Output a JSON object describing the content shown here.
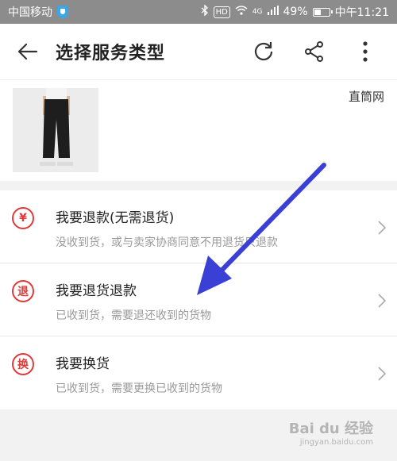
{
  "status_bar": {
    "carrier": "中国移动",
    "hd": "HD",
    "network": "4G",
    "battery": "49%",
    "battery_level": 0.49,
    "time": "中午11:21"
  },
  "header": {
    "title": "选择服务类型"
  },
  "product": {
    "shop_name": "直筒网"
  },
  "options": [
    {
      "icon_text": "¥",
      "title": "我要退款(无需退货)",
      "desc": "没收到货，或与卖家协商同意不用退货只退款"
    },
    {
      "icon_text": "退",
      "title": "我要退货退款",
      "desc": "已收到货，需要退还收到的货物"
    },
    {
      "icon_text": "换",
      "title": "我要换货",
      "desc": "已收到货，需要更换已收到的货物"
    }
  ],
  "watermark": {
    "brand": "Bai du 经验",
    "url": "jingyan.baidu.com"
  },
  "colors": {
    "accent_red": "#e03a3a",
    "annotation_arrow": "#3a3fd6"
  }
}
